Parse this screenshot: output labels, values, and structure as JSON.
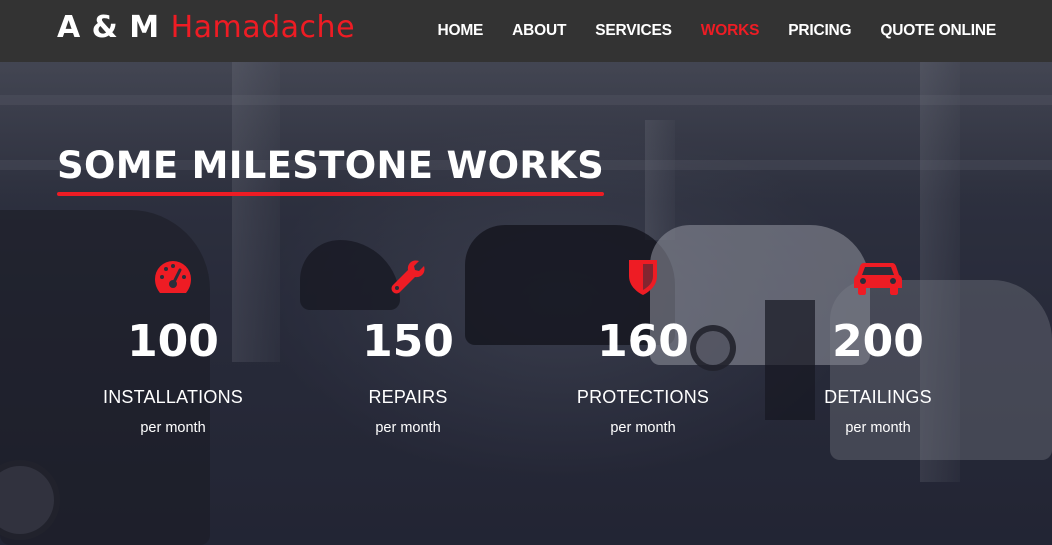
{
  "brand": {
    "first": "A & M",
    "second": "Hamadache",
    "accent_color": "#ee1c24"
  },
  "nav": {
    "items": [
      {
        "label": "HOME",
        "active": false
      },
      {
        "label": "ABOUT",
        "active": false
      },
      {
        "label": "SERVICES",
        "active": false
      },
      {
        "label": "WORKS",
        "active": true
      },
      {
        "label": "PRICING",
        "active": false
      },
      {
        "label": "QUOTE ONLINE",
        "active": false
      }
    ]
  },
  "section": {
    "title": "SOME MILESTONE WORKS"
  },
  "stats": [
    {
      "icon": "speedometer-icon",
      "value": "100",
      "label": "INSTALLATIONS",
      "sub": "per month"
    },
    {
      "icon": "wrench-icon",
      "value": "150",
      "label": "REPAIRS",
      "sub": "per month"
    },
    {
      "icon": "shield-icon",
      "value": "160",
      "label": "PROTECTIONS",
      "sub": "per month"
    },
    {
      "icon": "car-icon",
      "value": "200",
      "label": "DETAILINGS",
      "sub": "per month"
    }
  ]
}
